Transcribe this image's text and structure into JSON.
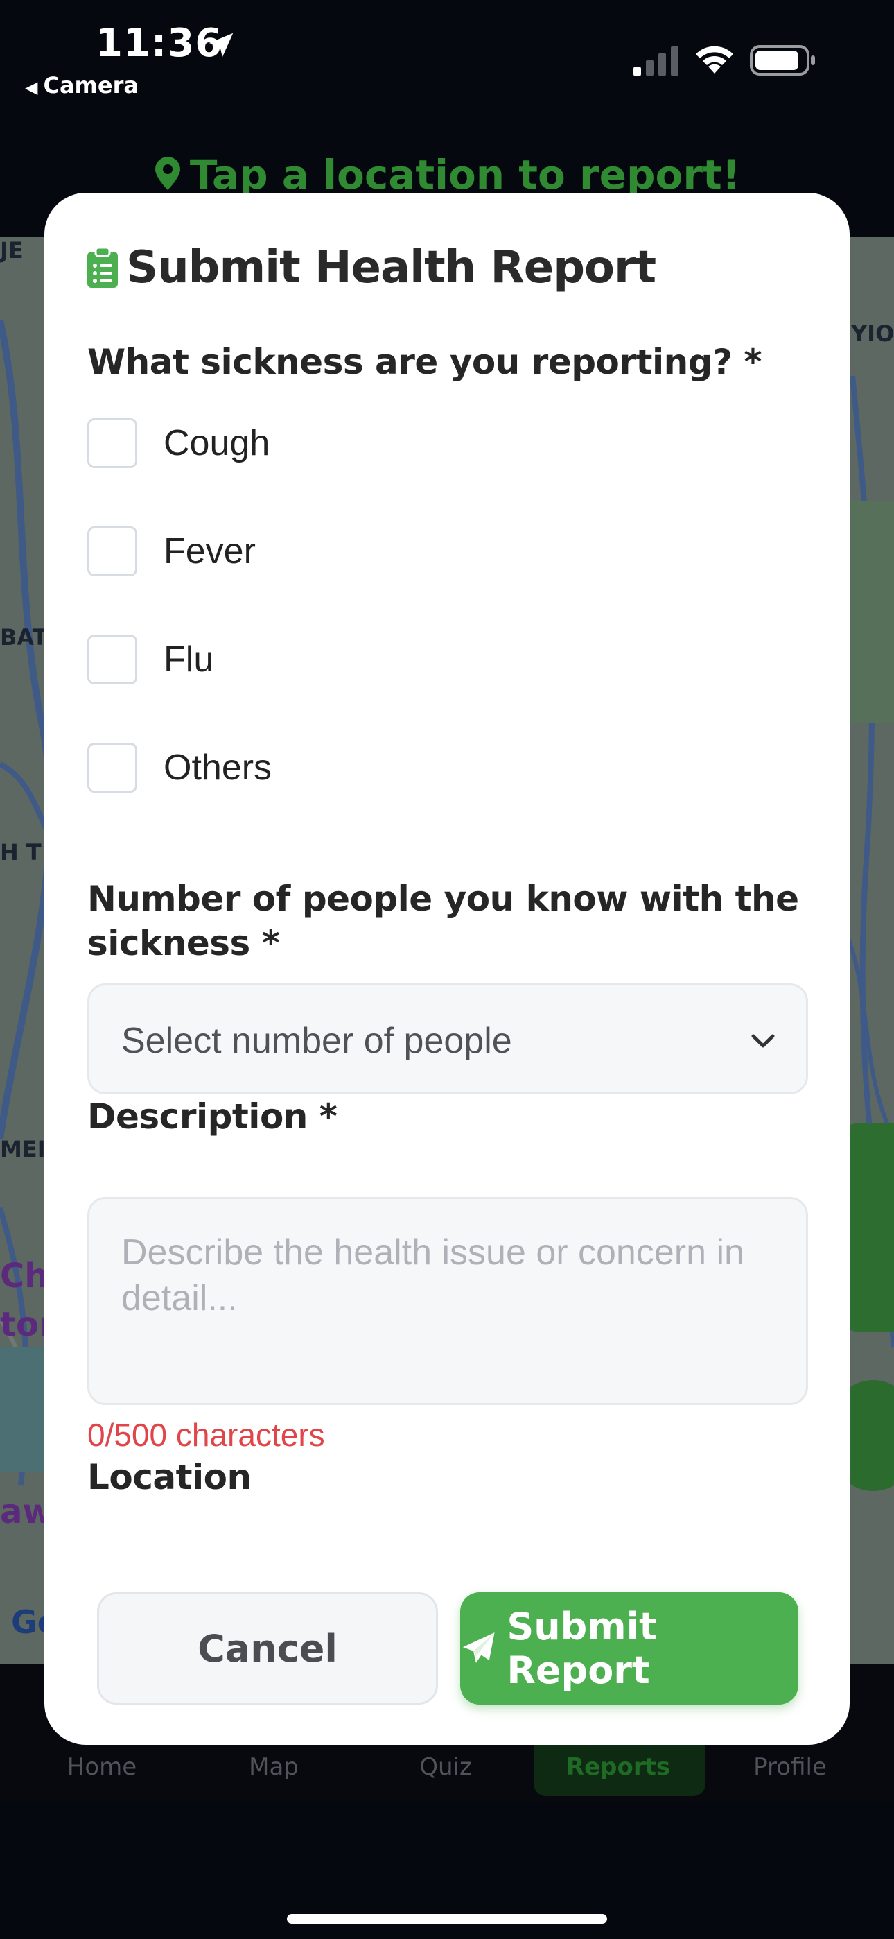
{
  "status_bar": {
    "time": "11:36",
    "back_label": "Camera"
  },
  "background": {
    "banner_text": "Tap a location to report!",
    "map_labels": [
      "JE",
      "BAT",
      "H T",
      "MEI",
      "Chi",
      "tor",
      "aw",
      "Go",
      "YIO"
    ],
    "tabs": [
      {
        "label": "Home",
        "active": false
      },
      {
        "label": "Map",
        "active": false
      },
      {
        "label": "Quiz",
        "active": false
      },
      {
        "label": "Reports",
        "active": true
      },
      {
        "label": "Profile",
        "active": false
      }
    ]
  },
  "modal": {
    "title": "Submit Health Report",
    "sickness_question": "What sickness are you reporting? *",
    "sickness_options": [
      {
        "label": "Cough",
        "checked": false
      },
      {
        "label": "Fever",
        "checked": false
      },
      {
        "label": "Flu",
        "checked": false
      },
      {
        "label": "Others",
        "checked": false
      }
    ],
    "people_label": "Number of people you know with the sickness *",
    "people_select_value": "Select number of people",
    "description_label": "Description *",
    "description_placeholder": "Describe the health issue or concern in detail...",
    "char_count": "0/500 characters",
    "location_label": "Location",
    "cancel_label": "Cancel",
    "submit_label": "Submit Report"
  },
  "colors": {
    "accent_green": "#4caf50",
    "error_red": "#e0454a",
    "background_dark": "#06080f"
  }
}
